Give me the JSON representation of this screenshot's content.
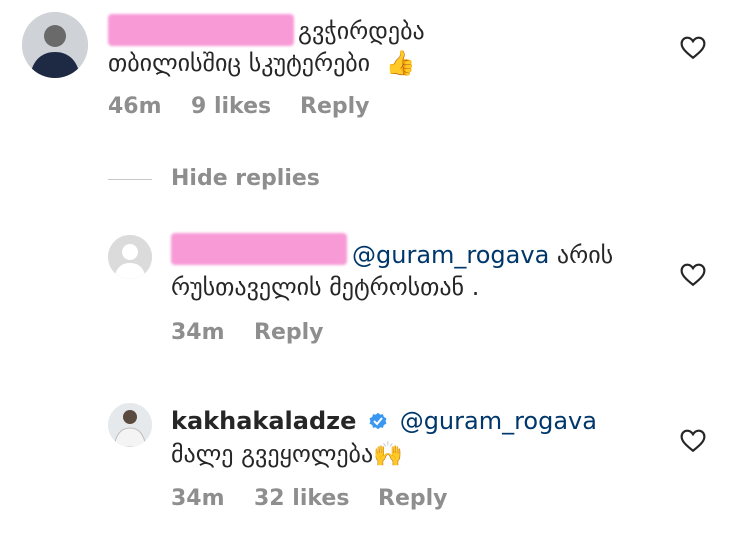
{
  "comments": [
    {
      "text": "გვჭირდება",
      "text_line2": "თბილისშიც სკუტერები",
      "emoji": "👍",
      "time": "46m",
      "likes": "9 likes",
      "reply": "Reply"
    },
    {
      "mention": "@guram_rogava",
      "text": "არის",
      "text_line2": "რუსთაველის მეტროსთან .",
      "time": "34m",
      "reply": "Reply"
    },
    {
      "username": "kakhakaladze",
      "mention": "@guram_rogava",
      "text_line2": "მალე გვეყოლება",
      "emoji": "🙌",
      "time": "34m",
      "likes": "32 likes",
      "reply": "Reply"
    }
  ],
  "hide_replies": "Hide replies",
  "colors": {
    "meta_gray": "#8e8e8e",
    "mention_blue": "#00376b",
    "verified_blue": "#3897f0",
    "redaction_pink": "#f79ad6"
  },
  "icons": [
    "avatar",
    "heart-icon",
    "verified-badge-icon",
    "thumbs-up-emoji",
    "raised-hands-emoji"
  ]
}
